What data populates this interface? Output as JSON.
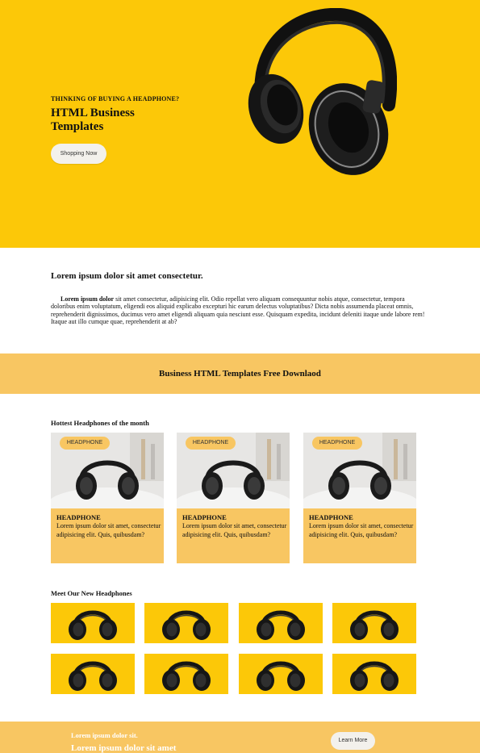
{
  "hero": {
    "kicker": "THINKING OF BUYING A HEADPHONE?",
    "title": "HTML Business Templates",
    "button_label": "Shopping Now",
    "background": "#fcc808"
  },
  "intro": {
    "heading": "Lorem ipsum dolor sit amet consectetur.",
    "lead": "Lorem ipsum dolor",
    "body": " sit amet consectetur, adipisicing elit. Odio repellat vero aliquam consequuntur nobis atque, consectetur, tempora doloribus enim voluptatum, eligendi eos aliquid explicabo excepturi hic earum delectus voluptatibus? Dicta nobis assumenda placeat omnis, reprehenderit dignissimos, ducimus vero amet eligendi aliquam quia nesciunt esse. Quisquam expedita, incidunt deleniti itaque unde labore rem! Itaque aut illo cumque quae, reprehenderit at ab?"
  },
  "banner": {
    "text": "Business HTML Templates Free Downlaod",
    "background": "#f8c662"
  },
  "hottest": {
    "title": "Hottest Headphones of the month",
    "cards": [
      {
        "badge": "HEADPHONE",
        "title": "HEADPHONE",
        "text": "Lorem ipsum dolor sit amet, consectetur adipisicing elit. Quis, quibusdam?"
      },
      {
        "badge": "HEADPHONE",
        "title": "HEADPHONE",
        "text": "Lorem ipsum dolor sit amet, consectetur adipisicing elit. Quis, quibusdam?"
      },
      {
        "badge": "HEADPHONE",
        "title": "HEADPHONE",
        "text": "Lorem ipsum dolor sit amet, consectetur adipisicing elit. Quis, quibusdam?"
      }
    ]
  },
  "new_headphones": {
    "title": "Meet Our New Headphones",
    "tile_count": 8
  },
  "footer": {
    "line1": "Lorem ipsum dolor sit.",
    "line2": "Lorem ipsum dolor sit amet",
    "button_label": "Learn More"
  }
}
